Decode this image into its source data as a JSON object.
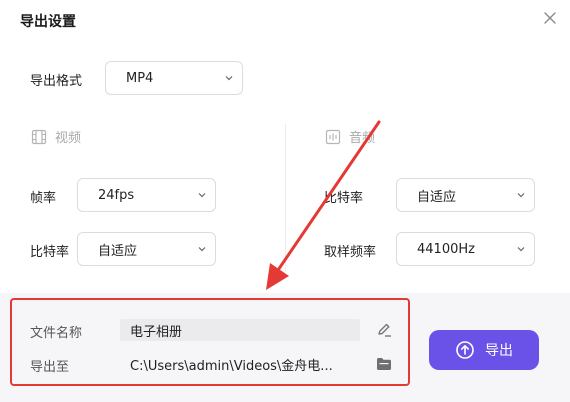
{
  "dialog": {
    "title": "导出设置",
    "close_icon": "close-icon"
  },
  "format": {
    "label": "导出格式",
    "value": "MP4"
  },
  "video": {
    "section_label": "视频",
    "icon": "film-icon",
    "frame_rate_label": "帧率",
    "frame_rate_value": "24fps",
    "bitrate_label": "比特率",
    "bitrate_value": "自适应"
  },
  "audio": {
    "section_label": "音频",
    "icon": "audio-wave-icon",
    "bitrate_label": "比特率",
    "bitrate_value": "自适应",
    "sample_rate_label": "取样频率",
    "sample_rate_value": "44100Hz"
  },
  "output": {
    "filename_label": "文件名称",
    "filename_value": "电子相册",
    "path_label": "导出至",
    "path_value": "C:\\Users\\admin\\Videos\\金舟电..."
  },
  "export_button": {
    "label": "导出",
    "icon": "upload-icon"
  },
  "colors": {
    "accent": "#6a52e8",
    "highlight_border": "#e53935",
    "panel_bg": "#f6f6f8"
  }
}
